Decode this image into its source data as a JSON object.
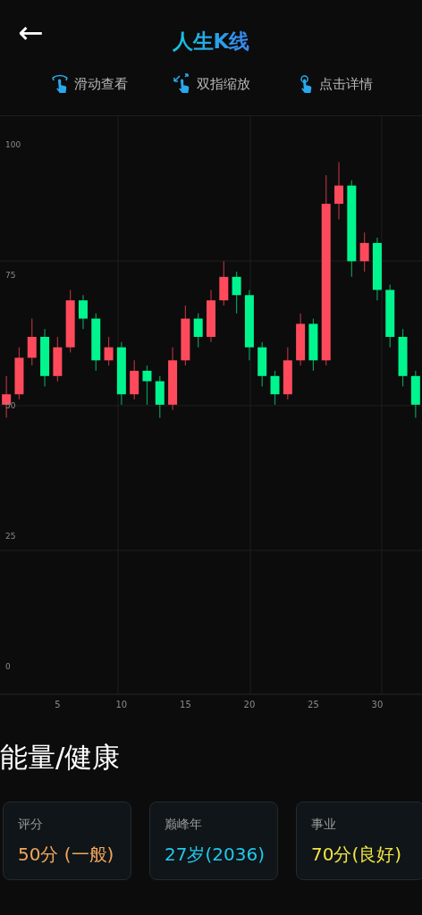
{
  "header": {
    "back_label": "←",
    "title": "人生K线"
  },
  "hints": [
    {
      "kind": "swipe",
      "label": "滑动查看"
    },
    {
      "kind": "pinch",
      "label": "双指缩放"
    },
    {
      "kind": "tap",
      "label": "点击详情"
    }
  ],
  "chart": {
    "chart_data": {
      "type": "candlestick",
      "xlim": [
        0.5,
        33.5
      ],
      "ylim": [
        -5.5,
        105.3
      ],
      "xticks": [
        5,
        10,
        15,
        20,
        25,
        30
      ],
      "yticks": [
        100,
        75,
        50,
        25,
        0
      ],
      "x": [
        1,
        2,
        3,
        4,
        5,
        6,
        7,
        8,
        9,
        10,
        11,
        12,
        13,
        14,
        15,
        16,
        17,
        18,
        19,
        20,
        21,
        22,
        23,
        24,
        25,
        26,
        27,
        28,
        29,
        30,
        31,
        32,
        33
      ],
      "ohlc": [
        [
          50,
          55.5,
          47.5,
          52
        ],
        [
          52,
          61,
          51,
          59
        ],
        [
          59,
          66.5,
          57.5,
          63
        ],
        [
          63,
          64.5,
          53.5,
          55.5
        ],
        [
          55.5,
          63,
          54.5,
          61
        ],
        [
          61,
          72,
          60,
          70
        ],
        [
          70,
          71,
          64.5,
          66.5
        ],
        [
          66.5,
          67.5,
          56.5,
          58.5
        ],
        [
          58.5,
          63,
          57.5,
          61
        ],
        [
          61,
          62,
          50,
          52
        ],
        [
          52,
          58.5,
          51,
          56.5
        ],
        [
          56.5,
          57.5,
          50,
          54.5
        ],
        [
          54.5,
          55.5,
          47.5,
          50
        ],
        [
          50,
          61,
          49,
          58.5
        ],
        [
          58.5,
          69,
          57.5,
          66.5
        ],
        [
          66.5,
          67.5,
          61,
          63
        ],
        [
          63,
          72,
          62,
          70
        ],
        [
          70,
          77.5,
          69,
          74.5
        ],
        [
          74.5,
          75.5,
          67.5,
          71
        ],
        [
          71,
          72,
          58.5,
          61
        ],
        [
          61,
          62,
          53.5,
          55.5
        ],
        [
          55.5,
          56.5,
          50,
          52
        ],
        [
          52,
          61,
          51,
          58.5
        ],
        [
          58.5,
          67.5,
          57.5,
          65.5
        ],
        [
          65.5,
          66.5,
          56.5,
          58.5
        ],
        [
          58.5,
          94,
          57.5,
          88.5
        ],
        [
          88.5,
          96.5,
          85.5,
          92
        ],
        [
          92,
          93,
          74.5,
          77.5
        ],
        [
          77.5,
          83,
          75.5,
          81
        ],
        [
          81,
          82,
          70,
          72
        ],
        [
          72,
          73,
          61,
          63
        ],
        [
          63,
          64.5,
          53.5,
          55.5
        ],
        [
          55.5,
          56.5,
          47.5,
          50
        ]
      ]
    }
  },
  "section": {
    "title": "能量/健康"
  },
  "cards": [
    {
      "label": "评分",
      "value": "50分 (一般)",
      "color": "#f2a65a"
    },
    {
      "label": "巅峰年",
      "value": "27岁(2036)",
      "color": "#22c8ec"
    },
    {
      "label": "事业",
      "value": "70分(良好)",
      "color": "#f2e544"
    }
  ]
}
